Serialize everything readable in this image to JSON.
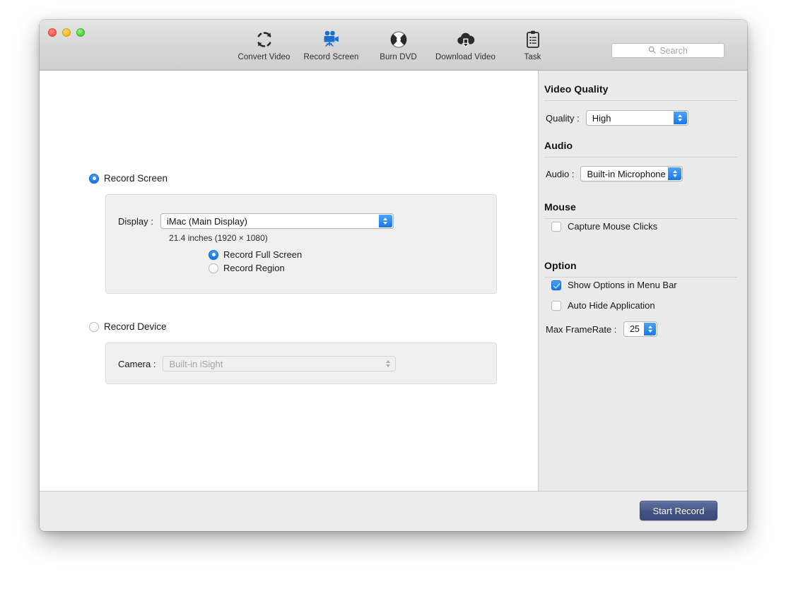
{
  "window": {
    "traffic_lights": [
      "close",
      "minimize",
      "maximize"
    ]
  },
  "toolbar": {
    "items": [
      {
        "label": "Convert Video",
        "icon": "convert-video-icon",
        "active": false
      },
      {
        "label": "Record Screen",
        "icon": "record-screen-icon",
        "active": true
      },
      {
        "label": "Burn DVD",
        "icon": "burn-dvd-icon",
        "active": false
      },
      {
        "label": "Download Video",
        "icon": "download-video-icon",
        "active": false
      },
      {
        "label": "Task",
        "icon": "task-icon",
        "active": false
      }
    ],
    "search": {
      "placeholder": "Search",
      "value": "",
      "icon": "search-icon"
    }
  },
  "main": {
    "record_screen": {
      "label": "Record Screen",
      "selected": true,
      "display_label": "Display :",
      "display_value": "iMac (Main Display)",
      "display_info": "21.4 inches (1920 × 1080)",
      "modes": [
        {
          "label": "Record Full Screen",
          "selected": true
        },
        {
          "label": "Record Region",
          "selected": false
        }
      ]
    },
    "record_device": {
      "label": "Record Device",
      "selected": false,
      "camera_label": "Camera :",
      "camera_value": "Built-in iSight",
      "disabled": true
    }
  },
  "sidebar": {
    "sections": [
      {
        "title": "Video Quality",
        "field_label": "Quality :",
        "field_value": "High"
      },
      {
        "title": "Audio",
        "field_label": "Audio :",
        "field_value": "Built-in Microphone"
      },
      {
        "title": "Mouse",
        "checkbox_label": "Capture Mouse Clicks",
        "checked": false
      },
      {
        "title": "Option",
        "checkbox1_label": "Show Options in Menu Bar",
        "checkbox1_checked": true,
        "checkbox2_label": "Auto Hide Application",
        "checkbox2_checked": false,
        "framerate_label": "Max FrameRate :",
        "framerate_value": "25"
      }
    ]
  },
  "footer": {
    "start_record_label": "Start Record"
  },
  "colors": {
    "accent_blue": "#1679ec",
    "active_icon_blue": "#1b6fd0",
    "button_blue": "#4a5c8d",
    "panel_gray": "#f0f0f0",
    "sidebar_gray": "#ebebeb"
  }
}
